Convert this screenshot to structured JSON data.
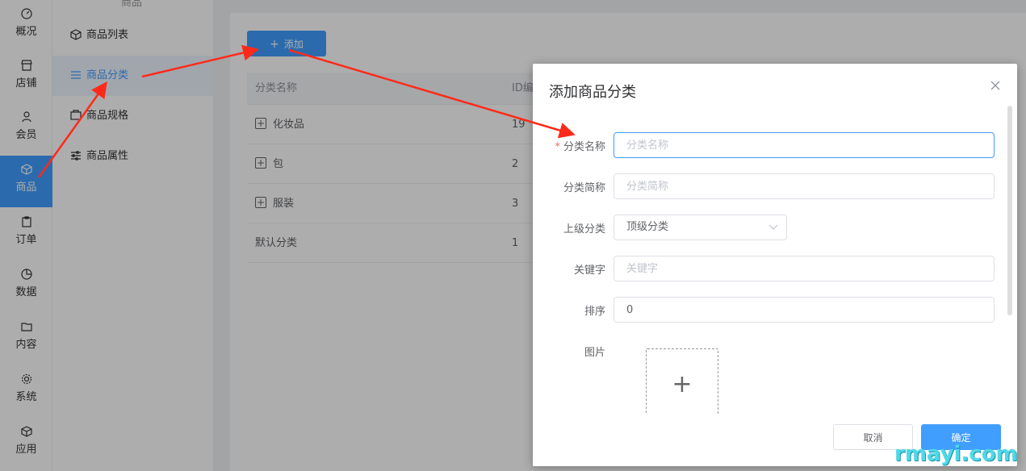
{
  "nav": {
    "items": [
      {
        "label": "概况",
        "icon": "dashboard-icon"
      },
      {
        "label": "店铺",
        "icon": "shop-icon"
      },
      {
        "label": "会员",
        "icon": "user-icon"
      },
      {
        "label": "商品",
        "icon": "box-icon",
        "active": true
      },
      {
        "label": "订单",
        "icon": "clipboard-icon"
      },
      {
        "label": "数据",
        "icon": "pie-icon"
      },
      {
        "label": "内容",
        "icon": "folder-icon"
      },
      {
        "label": "系统",
        "icon": "gear-icon"
      },
      {
        "label": "应用",
        "icon": "cube-icon"
      }
    ]
  },
  "subnav": {
    "title": "商品",
    "items": [
      {
        "label": "商品列表",
        "icon": "box-icon"
      },
      {
        "label": "商品分类",
        "icon": "list-icon",
        "active": true
      },
      {
        "label": "商品规格",
        "icon": "spec-icon"
      },
      {
        "label": "商品属性",
        "icon": "sliders-icon"
      }
    ]
  },
  "main": {
    "add_button": "添加",
    "table": {
      "headers": [
        "分类名称",
        "ID编"
      ],
      "rows": [
        {
          "name": "化妆品",
          "id": "19",
          "expandable": true
        },
        {
          "name": "包",
          "id": "2",
          "expandable": true
        },
        {
          "name": "服装",
          "id": "3",
          "expandable": true
        },
        {
          "name": "默认分类",
          "id": "1",
          "expandable": false
        }
      ]
    }
  },
  "dialog": {
    "title": "添加商品分类",
    "fields": {
      "name": {
        "label": "分类名称",
        "required_mark": "*",
        "placeholder": "分类名称",
        "value": ""
      },
      "short_name": {
        "label": "分类简称",
        "placeholder": "分类简称",
        "value": ""
      },
      "parent": {
        "label": "上级分类",
        "value": "顶级分类"
      },
      "keyword": {
        "label": "关键字",
        "placeholder": "关键字",
        "value": ""
      },
      "sort": {
        "label": "排序",
        "value": "0"
      },
      "image": {
        "label": "图片",
        "upload_symbol": "+"
      }
    },
    "cancel": "取消",
    "ok": "确定"
  },
  "watermark": "rmayi.com",
  "colors": {
    "accent": "#409eff",
    "arrow": "#ff2a1a",
    "required": "#f56c6c"
  }
}
